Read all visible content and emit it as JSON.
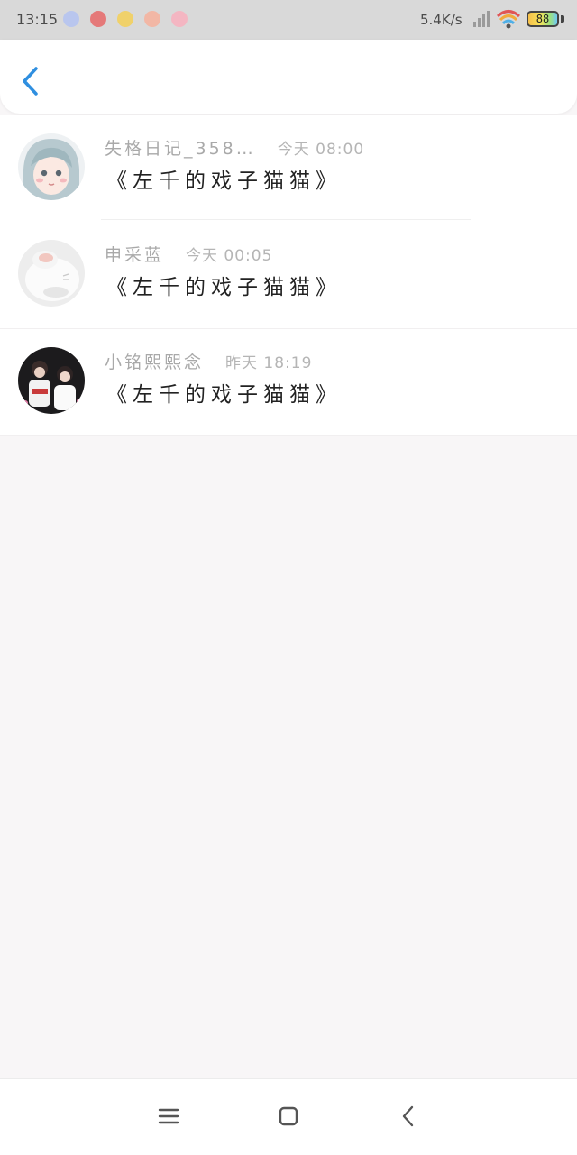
{
  "status_bar": {
    "time": "13:15",
    "net_speed": "5.4K/s",
    "battery": "88",
    "app_icons": [
      {
        "name": "app-icon-1",
        "color": "#b9c6ee"
      },
      {
        "name": "app-icon-2",
        "color": "#e57979"
      },
      {
        "name": "app-icon-3",
        "color": "#f0d16a"
      },
      {
        "name": "app-icon-4",
        "color": "#f2b7a5"
      },
      {
        "name": "app-icon-5",
        "color": "#f4b6c2"
      }
    ]
  },
  "header": {
    "back_icon": "chevron-left-icon",
    "accent_color": "#2f8fe0"
  },
  "messages": [
    {
      "name": "失格日记_358…",
      "time": "今天 08:00",
      "text": "《左千的戏子猫猫》"
    },
    {
      "name": "申采蓝",
      "time": "今天 00:05",
      "text": "《左千的戏子猫猫》"
    },
    {
      "name": "小铭熙熙念",
      "time": "昨天 18:19",
      "text": "《左千的戏子猫猫》"
    }
  ],
  "nav_bar": {
    "icons": [
      "menu-icon",
      "home-icon",
      "back-icon"
    ]
  }
}
